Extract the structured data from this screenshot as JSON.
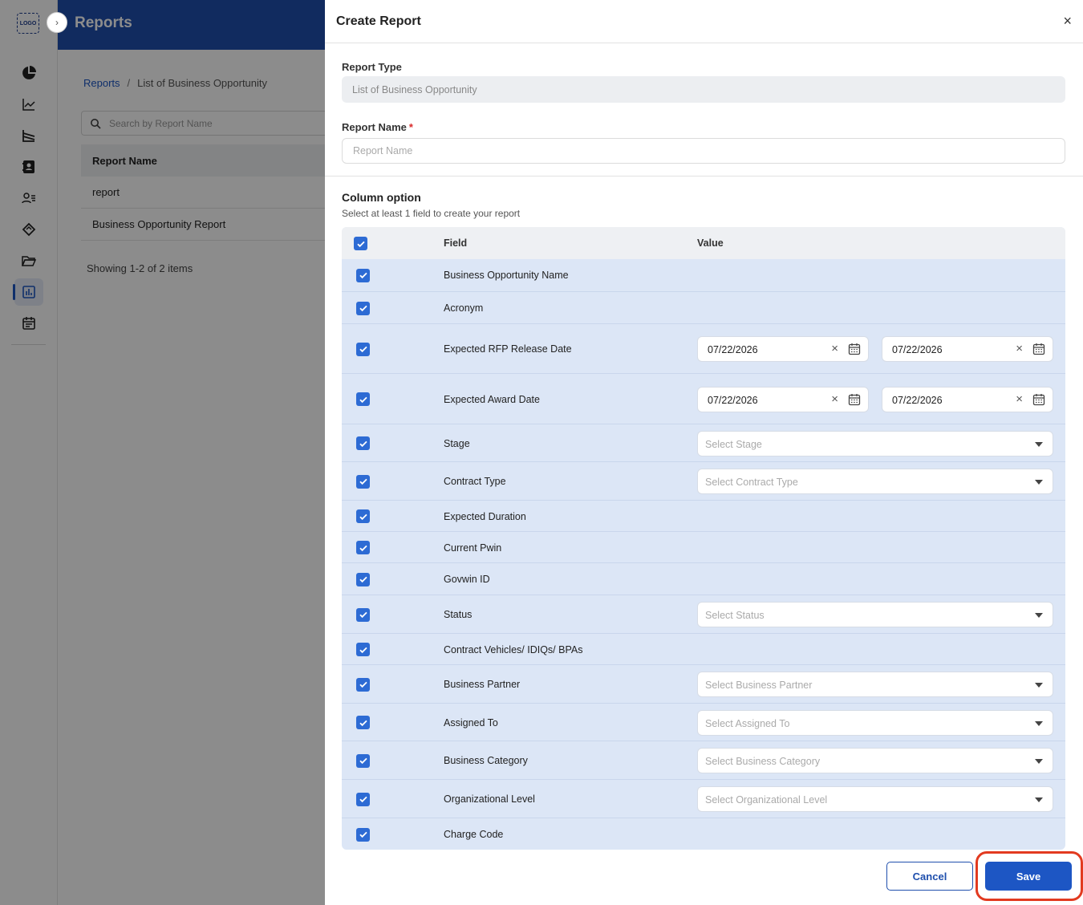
{
  "app": {
    "logo_text": "LOGO",
    "page_title": "Reports"
  },
  "breadcrumb": {
    "root": "Reports",
    "separator": "/",
    "current": "List of Business Opportunity"
  },
  "reports_list": {
    "search_placeholder": "Search by Report Name",
    "column_header": "Report Name",
    "rows": [
      "report",
      "Business Opportunity Report"
    ],
    "count_text": "Showing 1-2 of 2 items"
  },
  "drawer": {
    "title": "Create Report",
    "report_type": {
      "label": "Report Type",
      "value": "List of Business Opportunity"
    },
    "report_name": {
      "label": "Report Name",
      "required_mark": "*",
      "placeholder": "Report Name",
      "value": ""
    },
    "column_option": {
      "title": "Column option",
      "subtitle": "Select at least 1 field to create your report",
      "header_field": "Field",
      "header_value": "Value",
      "fields": [
        {
          "name": "Business Opportunity Name",
          "checked": true
        },
        {
          "name": "Acronym",
          "checked": true
        },
        {
          "name": "Expected RFP Release Date",
          "checked": true,
          "from": "07/22/2026",
          "to": "07/22/2026"
        },
        {
          "name": "Expected Award Date",
          "checked": true,
          "from": "07/22/2026",
          "to": "07/22/2026"
        },
        {
          "name": "Stage",
          "checked": true,
          "placeholder": "Select Stage"
        },
        {
          "name": "Contract Type",
          "checked": true,
          "placeholder": "Select Contract Type"
        },
        {
          "name": "Expected Duration",
          "checked": true
        },
        {
          "name": "Current Pwin",
          "checked": true
        },
        {
          "name": "Govwin ID",
          "checked": true
        },
        {
          "name": "Status",
          "checked": true,
          "placeholder": "Select Status"
        },
        {
          "name": "Contract Vehicles/ IDIQs/ BPAs",
          "checked": true
        },
        {
          "name": "Business Partner",
          "checked": true,
          "placeholder": "Select Business Partner"
        },
        {
          "name": "Assigned To",
          "checked": true,
          "placeholder": "Select Assigned To"
        },
        {
          "name": "Business Category",
          "checked": true,
          "placeholder": "Select Business Category"
        },
        {
          "name": "Organizational Level",
          "checked": true,
          "placeholder": "Select Organizational Level"
        },
        {
          "name": "Charge Code",
          "checked": true
        }
      ]
    },
    "cancel_label": "Cancel",
    "save_label": "Save",
    "close_glyph": "×"
  },
  "colors": {
    "primary": "#1d56c4",
    "header_bar": "#1f4fad",
    "table_bg": "#dce6f6",
    "highlight": "#e23a20"
  }
}
